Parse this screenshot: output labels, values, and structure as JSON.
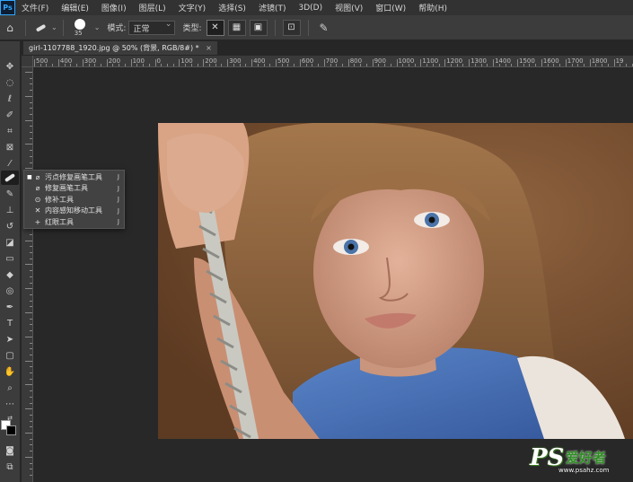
{
  "menubar": {
    "logo": "Ps",
    "items": [
      "文件(F)",
      "编辑(E)",
      "图像(I)",
      "图层(L)",
      "文字(Y)",
      "选择(S)",
      "滤镜(T)",
      "3D(D)",
      "视图(V)",
      "窗口(W)",
      "帮助(H)"
    ]
  },
  "options": {
    "brush_size": "35",
    "mode_label": "模式:",
    "mode_value": "正常",
    "type_label": "类型:"
  },
  "document_tab": {
    "title": "girl-1107788_1920.jpg @ 50% (背景, RGB/8#) *",
    "close": "×"
  },
  "ruler": {
    "h_labels": [
      "500",
      "400",
      "300",
      "200",
      "100",
      "0",
      "100",
      "200",
      "300",
      "400",
      "500",
      "600",
      "700",
      "800",
      "900",
      "1000",
      "1100",
      "1200",
      "1300",
      "1400",
      "1500",
      "1600",
      "1700",
      "1800",
      "19"
    ]
  },
  "flyout": {
    "items": [
      {
        "label": "污点修复画笔工具",
        "key": "J",
        "icon": "spot-healing-icon",
        "selected": true
      },
      {
        "label": "修复画笔工具",
        "key": "J",
        "icon": "healing-brush-icon",
        "selected": false
      },
      {
        "label": "修补工具",
        "key": "J",
        "icon": "patch-icon",
        "selected": false
      },
      {
        "label": "内容感知移动工具",
        "key": "J",
        "icon": "content-aware-move-icon",
        "selected": false
      },
      {
        "label": "红眼工具",
        "key": "J",
        "icon": "red-eye-icon",
        "selected": false
      }
    ]
  },
  "watermark": {
    "ps": "PS",
    "cn": "爱好者",
    "url": "www.psahz.com"
  },
  "colors": {
    "accent": "#31a8ff",
    "panel": "#3c3c3c",
    "canvas": "#282828"
  }
}
